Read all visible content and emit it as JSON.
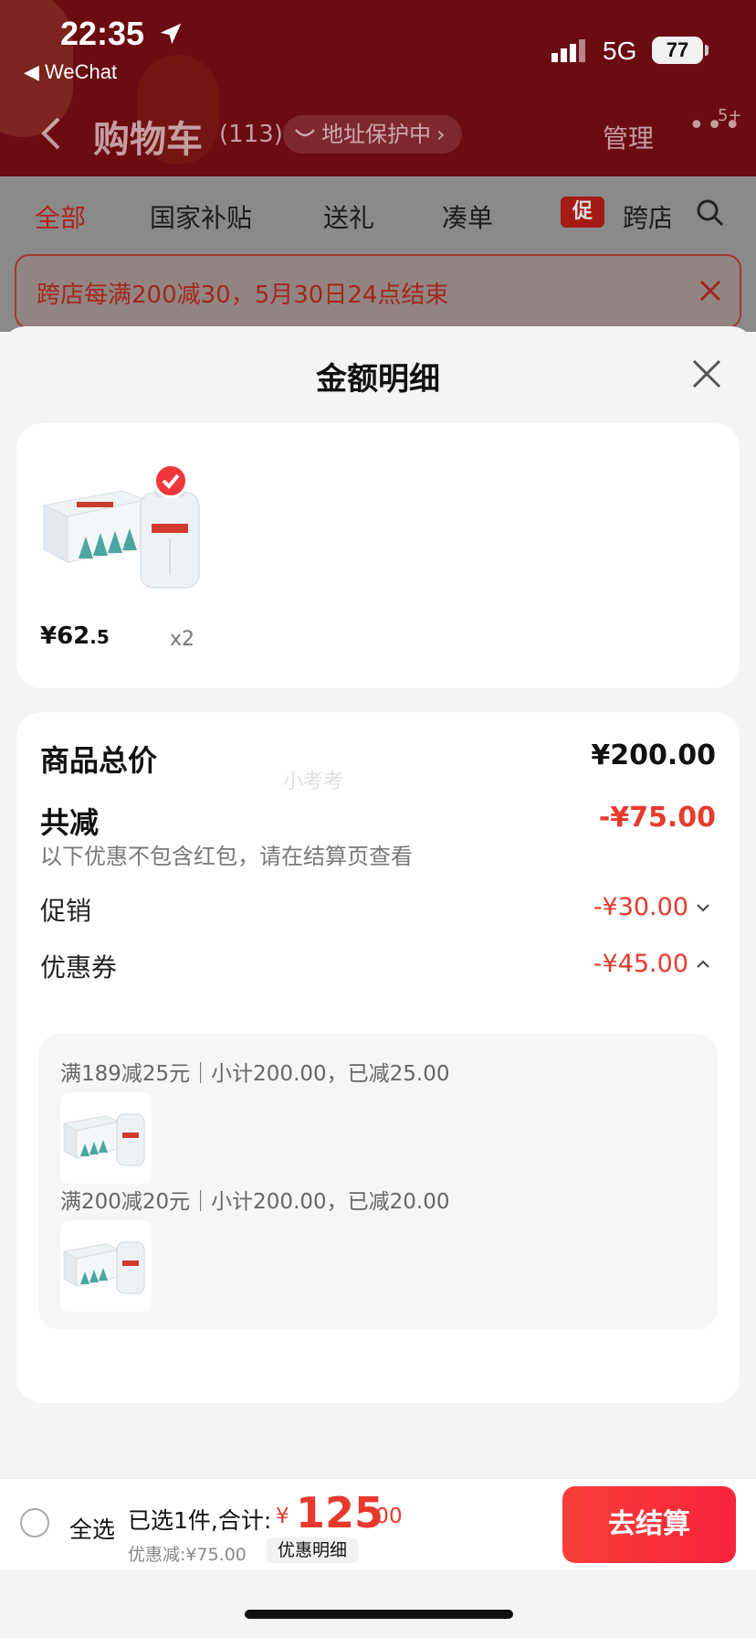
{
  "status_bar": {
    "time": "22:35",
    "back_app": "◀ WeChat",
    "network": "5G",
    "battery": "77"
  },
  "header": {
    "title": "购物车",
    "count": "(113)",
    "address_protect": "地址保护中",
    "address_chevron": "›",
    "manage": "管理",
    "more": "•••",
    "badge": "5+"
  },
  "tabs": [
    {
      "label": "全部"
    },
    {
      "label": "国家补贴"
    },
    {
      "label": "送礼"
    },
    {
      "label": "凑单"
    },
    {
      "label": "跨店"
    }
  ],
  "promo_tag": "促",
  "banner_text": "跨店每满200减30，5月30日24点结束",
  "sheet": {
    "title": "金额明细",
    "item": {
      "price_int": "¥62",
      "price_dec": ".5",
      "qty": "x2"
    },
    "watermark": "小考考",
    "summary": {
      "total_label": "商品总价",
      "total_value": "¥200.00",
      "discount_label": "共减",
      "discount_value": "-¥75.00",
      "note": "以下优惠不包含红包，请在结算页查看",
      "promo_label": "促销",
      "promo_value": "-¥30.00",
      "coupon_label": "优惠券",
      "coupon_value": "-¥45.00"
    },
    "coupons": [
      {
        "text": "满189减25元｜小计200.00，已减25.00"
      },
      {
        "text": "满200减20元｜小计200.00，已减20.00"
      }
    ]
  },
  "bottom_bar": {
    "select_all": "全选",
    "selected_text": "已选1件,合计:",
    "currency": "¥",
    "total_int": "125",
    "total_dec": ".00",
    "savings": "优惠减:¥75.00",
    "detail_link": "优惠明细",
    "checkout": "去结算"
  },
  "colors": {
    "accent_red": "#e8392d",
    "checkout_red": "#f8233a",
    "header_bg": "#6b0b12"
  }
}
